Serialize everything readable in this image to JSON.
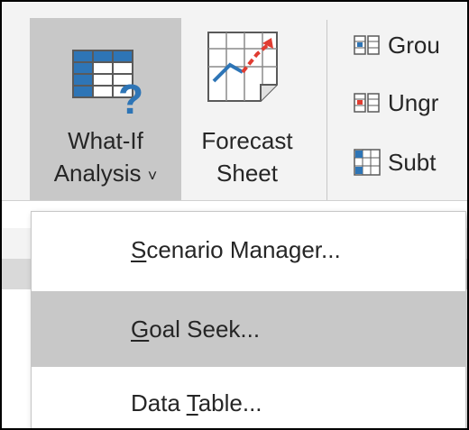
{
  "ribbon": {
    "whatif": {
      "line1": "What-If",
      "line2": "Analysis",
      "chevron": "⌄",
      "icon": "what-if-table-icon"
    },
    "forecast": {
      "line1": "Forecast",
      "line2": "Sheet",
      "icon": "forecast-chart-icon"
    },
    "outline": [
      {
        "label": "Grou",
        "icon": "group-icon"
      },
      {
        "label": "Ungr",
        "icon": "ungroup-icon"
      },
      {
        "label": "Subt",
        "icon": "subtotal-icon"
      }
    ]
  },
  "menu": {
    "items": [
      {
        "label": "Scenario Manager...",
        "hotkey": "S",
        "rest": "cenario Manager..."
      },
      {
        "label": "Goal Seek...",
        "hotkey": "G",
        "rest": "oal Seek...",
        "highlighted": true
      },
      {
        "label": "Data Table...",
        "prefix": "Data ",
        "hotkey": "T",
        "rest": "able..."
      }
    ]
  },
  "colors": {
    "ribbon_bg": "#f3f3f3",
    "selected_bg": "#c8c8c8",
    "icon_blue": "#2e75b6",
    "icon_red": "#e03c31",
    "text": "#262626"
  }
}
